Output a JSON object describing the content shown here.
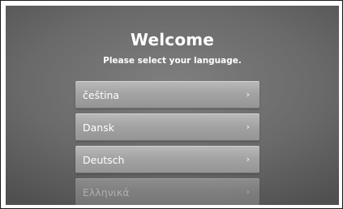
{
  "header": {
    "title": "Welcome",
    "subtitle": "Please select your language."
  },
  "languages": [
    {
      "label": "čeština",
      "chevron": "›"
    },
    {
      "label": "Dansk",
      "chevron": "›"
    },
    {
      "label": "Deutsch",
      "chevron": "›"
    },
    {
      "label": "Ελληνικά",
      "chevron": "›"
    }
  ]
}
